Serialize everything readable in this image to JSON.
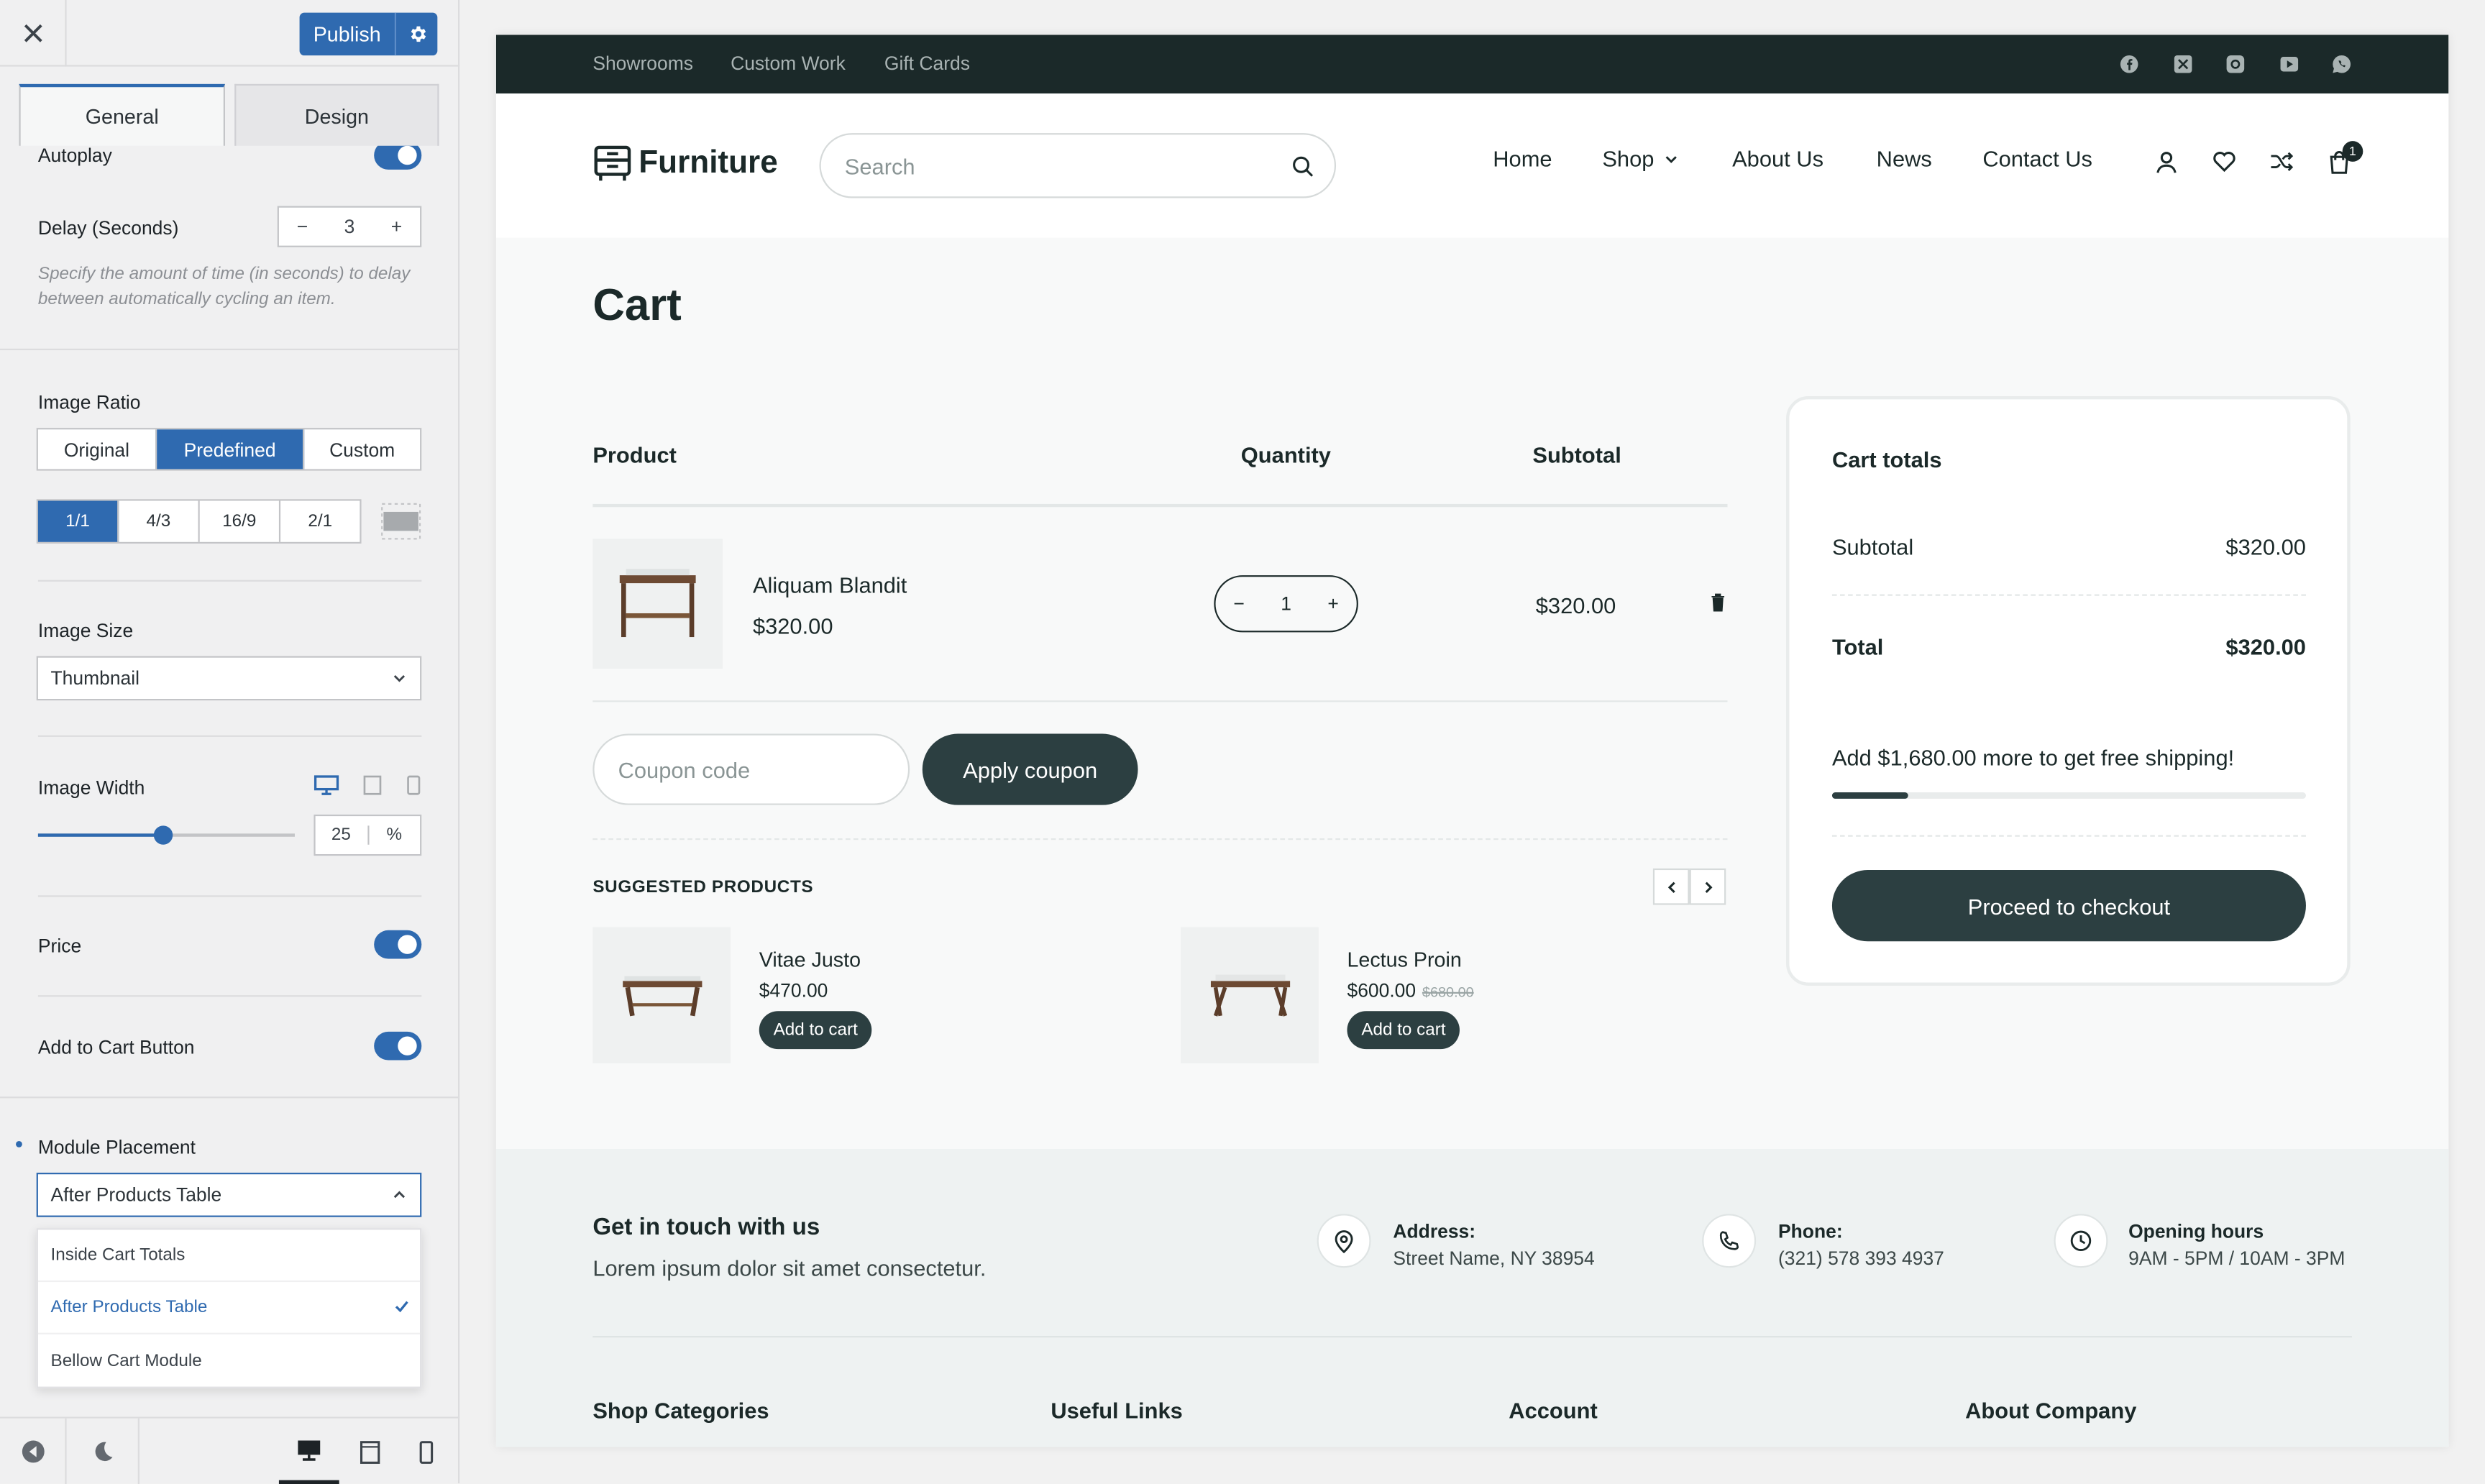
{
  "panel": {
    "publish_label": "Publish",
    "tabs": [
      "General",
      "Design"
    ],
    "autoplay_label": "Autoplay",
    "delay_label": "Delay (Seconds)",
    "delay_value": "3",
    "delay_help": "Specify the amount of time (in seconds) to delay between automatically cycling an item.",
    "image_ratio_label": "Image Ratio",
    "ratio_modes": [
      "Original",
      "Predefined",
      "Custom"
    ],
    "ratio_mode_selected": "Predefined",
    "ratios": [
      "1/1",
      "4/3",
      "16/9",
      "2/1"
    ],
    "ratio_selected": "1/1",
    "image_size_label": "Image Size",
    "image_size_value": "Thumbnail",
    "image_width_label": "Image Width",
    "image_width_value": "25",
    "image_width_unit": "%",
    "image_width_slider_fraction": 0.49,
    "price_label": "Price",
    "add_to_cart_label": "Add to Cart Button",
    "module_placement_label": "Module Placement",
    "module_placement_value": "After Products Table",
    "placement_options": [
      "Inside Cart Totals",
      "After Products Table",
      "Bellow Cart Module"
    ],
    "icons": [
      "close-icon",
      "gear-icon",
      "back-icon",
      "dark-mode-icon",
      "desktop-icon",
      "tablet-icon",
      "mobile-icon"
    ],
    "accent_color": "#2f6ab0"
  },
  "site": {
    "top_links": [
      "Showrooms",
      "Custom Work",
      "Gift Cards"
    ],
    "social_icons": [
      "facebook-icon",
      "x-icon",
      "instagram-icon",
      "youtube-icon",
      "whatsapp-icon"
    ],
    "logo_text": "Furniture",
    "search_placeholder": "Search",
    "nav": [
      "Home",
      "Shop",
      "About Us",
      "News",
      "Contact Us"
    ],
    "cart_count": "1",
    "page_title": "Cart",
    "table_headers": {
      "product": "Product",
      "quantity": "Quantity",
      "subtotal": "Subtotal"
    },
    "cart_item": {
      "name": "Aliquam Blandit",
      "price": "$320.00",
      "quantity": "1",
      "subtotal": "$320.00"
    },
    "coupon_placeholder": "Coupon code",
    "apply_coupon_label": "Apply coupon",
    "suggested_title": "SUGGESTED PRODUCTS",
    "suggested": [
      {
        "name": "Vitae Justo",
        "price": "$470.00",
        "old_price": "",
        "button": "Add to cart"
      },
      {
        "name": "Lectus Proin",
        "price": "$600.00",
        "old_price": "$680.00",
        "button": "Add to cart"
      }
    ],
    "totals": {
      "title": "Cart totals",
      "subtotal_label": "Subtotal",
      "subtotal_value": "$320.00",
      "total_label": "Total",
      "total_value": "$320.00",
      "shipping_message": "Add $1,680.00 more to get free shipping!",
      "shipping_progress": 0.16,
      "checkout_label": "Proceed to checkout"
    },
    "footer": {
      "contact_title": "Get in touch with us",
      "contact_sub": "Lorem ipsum dolor sit amet consectetur.",
      "address_label": "Address:",
      "address_value": "Street Name, NY 38954",
      "phone_label": "Phone:",
      "phone_value": "(321) 578 393 4937",
      "hours_label": "Opening hours",
      "hours_value": "9AM - 5PM / 10AM - 3PM",
      "columns": [
        "Shop Categories",
        "Useful Links",
        "Account",
        "About Company"
      ]
    },
    "dark_color": "#1b2929",
    "button_color": "#2c3f41"
  }
}
